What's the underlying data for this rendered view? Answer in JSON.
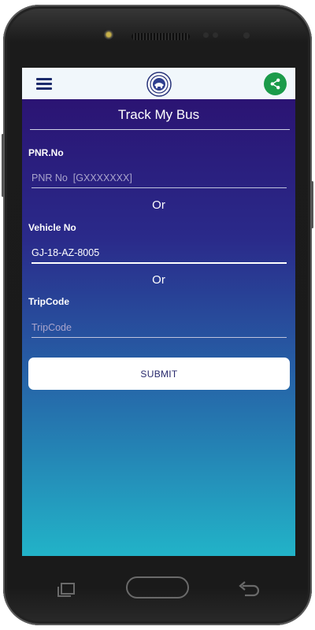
{
  "app": {
    "title": "Track My Bus"
  },
  "appbar": {
    "menu_icon": "hamburger-icon",
    "logo_icon": "emblem-logo-icon",
    "share_icon": "share-icon",
    "share_color": "#1b9b4a"
  },
  "form": {
    "pnr_label": "PNR.No",
    "pnr_placeholder": "PNR No  [GXXXXXXX]",
    "pnr_value": "",
    "or_1": "Or",
    "vehicle_label": "Vehicle No",
    "vehicle_value": "GJ-18-AZ-8005",
    "or_2": "Or",
    "tripcode_label": "TripCode",
    "tripcode_placeholder": "TripCode",
    "tripcode_value": "",
    "submit_label": "SUBMIT"
  },
  "colors": {
    "gradient_top": "#2b0f6e",
    "gradient_bottom": "#22b3c8",
    "appbar_bg": "#f1f7fb",
    "button_text": "#2a2b6e"
  }
}
